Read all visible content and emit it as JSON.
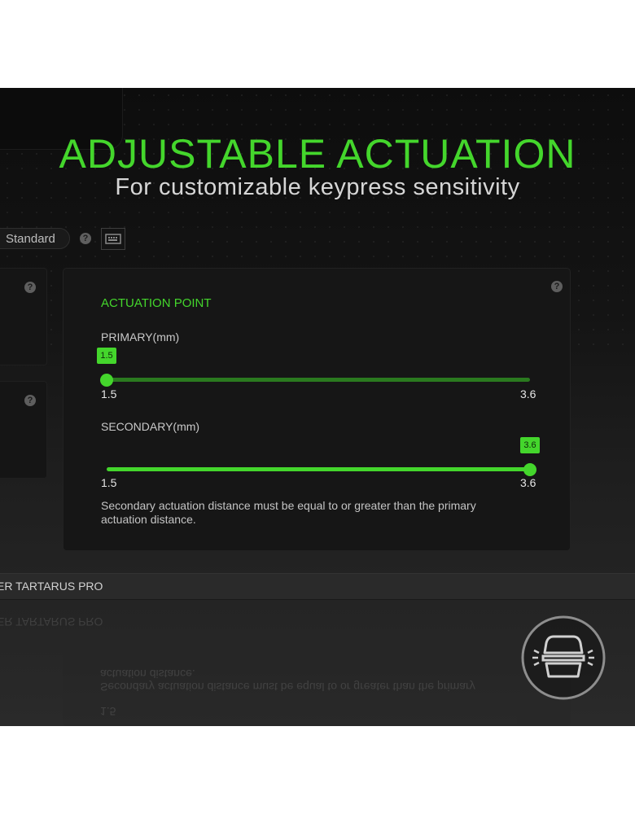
{
  "hero": {
    "title": "ADJUSTABLE ACTUATION",
    "subtitle": "For customizable keypress sensitivity"
  },
  "toolbar": {
    "mode_value": "Standard",
    "help_glyph": "?",
    "keyboard_icon": "keyboard-icon"
  },
  "actuation": {
    "title": "ACTUATION POINT",
    "primary": {
      "label": "PRIMARY(mm)",
      "value": 1.5,
      "value_text": "1.5",
      "min": 1.5,
      "max": 3.6,
      "min_text": "1.5",
      "max_text": "3.6"
    },
    "secondary": {
      "label": "SECONDARY(mm)",
      "value": 3.6,
      "value_text": "3.6",
      "min": 1.5,
      "max": 3.6,
      "min_text": "1.5",
      "max_text": "3.6"
    },
    "note": "Secondary actuation distance must be equal to or greater than the primary actuation distance."
  },
  "device": {
    "name": "ER TARTARUS PRO"
  },
  "feature_icon": "keycap-actuation-icon",
  "colors": {
    "accent": "#44d62c",
    "track_dim": "#2a7a1f",
    "panel": "#161616",
    "background": "#111111"
  }
}
